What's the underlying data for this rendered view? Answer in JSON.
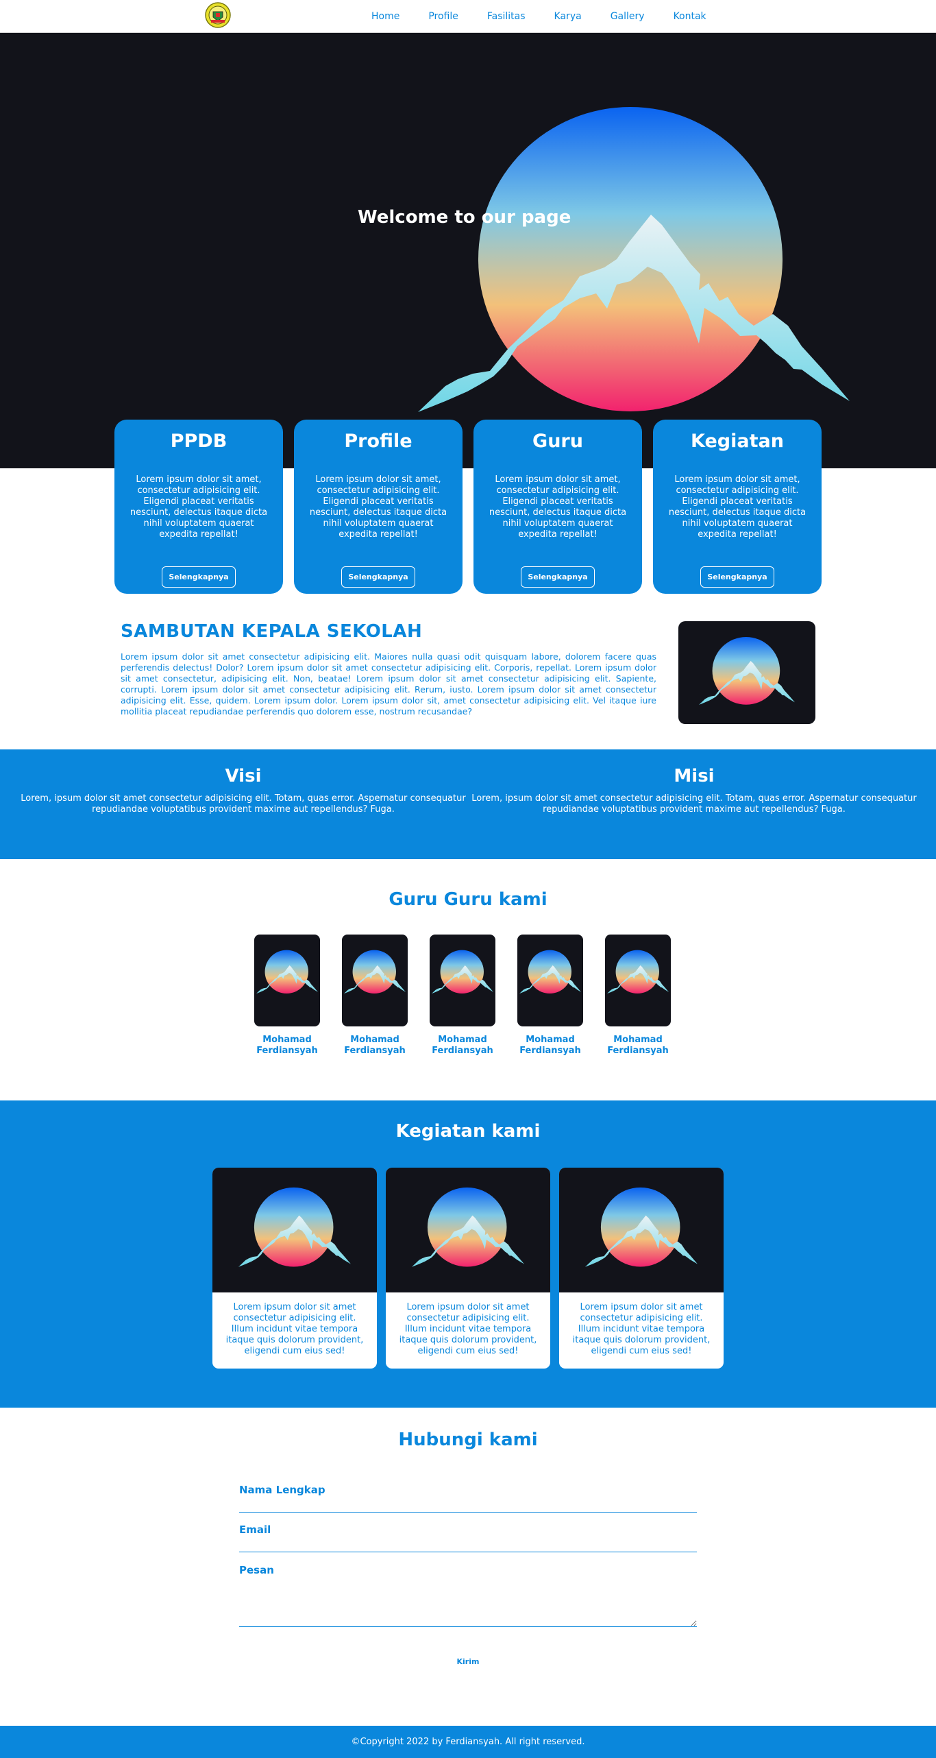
{
  "nav": {
    "logo_icon": "school-emblem-icon",
    "links": [
      "Home",
      "Profile",
      "Fasilitas",
      "Karya",
      "Gallery",
      "Kontak"
    ]
  },
  "hero": {
    "title": "Welcome to our page",
    "image_icon": "sunset-mountain-icon"
  },
  "cards": [
    {
      "title": "PPDB",
      "text": "Lorem ipsum dolor sit amet, consectetur adipisicing elit. Eligendi placeat veritatis nesciunt, delectus itaque dicta nihil voluptatem quaerat expedita repellat!",
      "button": "Selengkapnya"
    },
    {
      "title": "Profile",
      "text": "Lorem ipsum dolor sit amet, consectetur adipisicing elit. Eligendi placeat veritatis nesciunt, delectus itaque dicta nihil voluptatem quaerat expedita repellat!",
      "button": "Selengkapnya"
    },
    {
      "title": "Guru",
      "text": "Lorem ipsum dolor sit amet, consectetur adipisicing elit. Eligendi placeat veritatis nesciunt, delectus itaque dicta nihil voluptatem quaerat expedita repellat!",
      "button": "Selengkapnya"
    },
    {
      "title": "Kegiatan",
      "text": "Lorem ipsum dolor sit amet, consectetur adipisicing elit. Eligendi placeat veritatis nesciunt, delectus itaque dicta nihil voluptatem quaerat expedita repellat!",
      "button": "Selengkapnya"
    }
  ],
  "sambutan": {
    "title": "SAMBUTAN KEPALA SEKOLAH",
    "text": "Lorem ipsum dolor sit amet consectetur adipisicing elit. Maiores nulla quasi odit quisquam labore, dolorem facere quas perferendis delectus! Dolor? Lorem ipsum dolor sit amet consectetur adipisicing elit. Corporis, repellat. Lorem ipsum dolor sit amet consectetur, adipisicing elit. Non, beatae! Lorem ipsum dolor sit amet consectetur adipisicing elit. Sapiente, corrupti. Lorem ipsum dolor sit amet consectetur adipisicing elit. Rerum, iusto. Lorem ipsum dolor sit amet consectetur adipisicing elit. Esse, quidem. Lorem ipsum dolor. Lorem ipsum dolor sit, amet consectetur adipisicing elit. Vel itaque iure mollitia placeat repudiandae perferendis quo dolorem esse, nostrum recusandae?"
  },
  "visi": {
    "title": "Visi",
    "text": "Lorem, ipsum dolor sit amet consectetur adipisicing elit. Totam, quas error. Aspernatur consequatur repudiandae voluptatibus provident maxime aut repellendus? Fuga."
  },
  "misi": {
    "title": "Misi",
    "text": "Lorem, ipsum dolor sit amet consectetur adipisicing elit. Totam, quas error. Aspernatur consequatur repudiandae voluptatibus provident maxime aut repellendus? Fuga."
  },
  "guru": {
    "title": "Guru Guru kami",
    "members": [
      {
        "name": "Mohamad Ferdiansyah"
      },
      {
        "name": "Mohamad Ferdiansyah"
      },
      {
        "name": "Mohamad Ferdiansyah"
      },
      {
        "name": "Mohamad Ferdiansyah"
      },
      {
        "name": "Mohamad Ferdiansyah"
      }
    ]
  },
  "kegiatan": {
    "title": "Kegiatan kami",
    "items": [
      {
        "text": "Lorem ipsum dolor sit amet consectetur adipisicing elit. Illum incidunt vitae tempora itaque quis dolorum provident, eligendi cum eius sed!"
      },
      {
        "text": "Lorem ipsum dolor sit amet consectetur adipisicing elit. Illum incidunt vitae tempora itaque quis dolorum provident, eligendi cum eius sed!"
      },
      {
        "text": "Lorem ipsum dolor sit amet consectetur adipisicing elit. Illum incidunt vitae tempora itaque quis dolorum provident, eligendi cum eius sed!"
      }
    ]
  },
  "kontak": {
    "title": "Hubungi kami",
    "name_label": "Nama Lengkap",
    "email_label": "Email",
    "message_label": "Pesan",
    "submit": "Kirim"
  },
  "footer": {
    "text": "©Copyright 2022 by Ferdiansyah. All right reserved."
  },
  "colors": {
    "primary": "#0a87dc",
    "hero_bg": "#12131a",
    "white": "#ffffff"
  }
}
